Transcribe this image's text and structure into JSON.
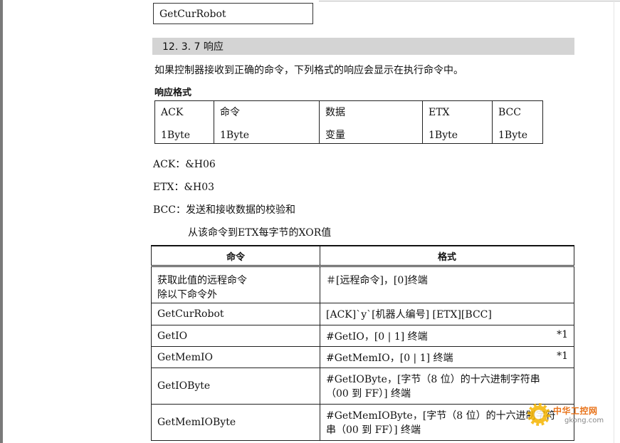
{
  "top_box": {
    "text": "GetCurRobot"
  },
  "section": {
    "heading": "12. 3. 7 响应"
  },
  "intro": "如果控制器接收到正确的命令，下列格式的响应会显示在执行命令中。",
  "response_format_label": "响应格式",
  "response_table": [
    {
      "line1": "ACK",
      "line2": "1Byte"
    },
    {
      "line1": "命令",
      "line2": "1Byte"
    },
    {
      "line1": "数据",
      "line2": "变量"
    },
    {
      "line1": "ETX",
      "line2": "1Byte"
    },
    {
      "line1": "BCC",
      "line2": "1Byte"
    }
  ],
  "defs": {
    "ack": "ACK：&H06",
    "etx": "ETX：&H03",
    "bcc": "BCC：发送和接收数据的校验和",
    "bcc_detail": "从该命令到ETX每字节的XOR值"
  },
  "command_table": {
    "headers": [
      "命令",
      "格式"
    ],
    "rows": [
      {
        "cmd": [
          "获取此值的远程命令",
          "除以下命令外"
        ],
        "format": [
          "＃[远程命令]，[0]终端"
        ],
        "note": ""
      },
      {
        "cmd": [
          "GetCurRobot"
        ],
        "format": [
          "[ACK]`y`[机器人编号] [ETX][BCC]"
        ],
        "note": ""
      },
      {
        "cmd": [
          "GetIO"
        ],
        "format": [
          "#GetIO，[0 | 1] 终端"
        ],
        "note": "*1"
      },
      {
        "cmd": [
          "GetMemIO"
        ],
        "format": [
          "#GetMemIO，[0 | 1] 终端"
        ],
        "note": "*1"
      },
      {
        "cmd": [
          "GetIOByte"
        ],
        "format": [
          "#GetIOByte，[字节（8 位）的十六进制字符串",
          "（00 到 FF）] 终端"
        ],
        "note": ""
      },
      {
        "cmd": [
          "GetMemIOByte"
        ],
        "format": [
          "#GetMemIOByte，[字节（8 位）的十六进制字符",
          "串（00 到 FF）] 终端"
        ],
        "note": ""
      }
    ]
  },
  "watermark": {
    "title": "中华工控网",
    "url": "gkong.com"
  }
}
